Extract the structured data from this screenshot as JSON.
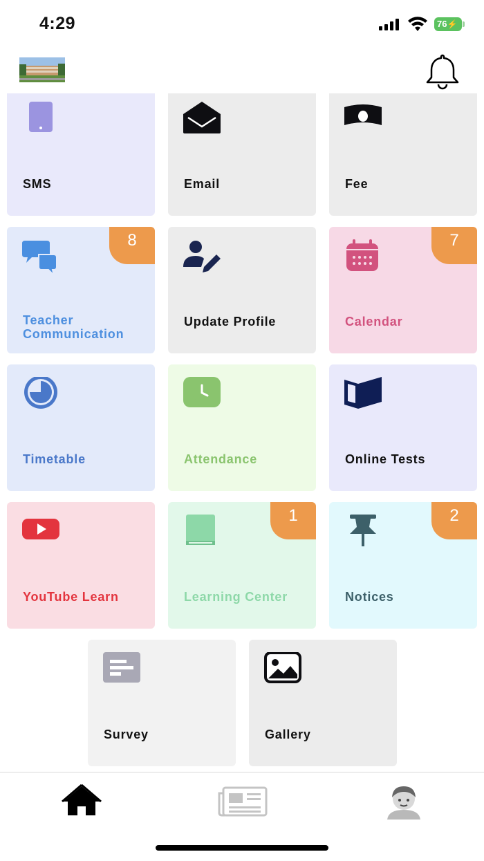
{
  "status": {
    "time": "4:29",
    "battery": "76"
  },
  "tiles": [
    {
      "id": "sms",
      "label": "SMS",
      "icon": "phone-icon",
      "bg": "#e9e9fb",
      "color": "#111111"
    },
    {
      "id": "email",
      "label": "Email",
      "icon": "envelope-open-icon",
      "bg": "#ececec",
      "color": "#111111"
    },
    {
      "id": "fee",
      "label": "Fee",
      "icon": "money-bill-icon",
      "bg": "#ececec",
      "color": "#111111"
    },
    {
      "id": "teacher-communication",
      "label1": "Teacher",
      "label2": "Communication",
      "icon": "chat-bubbles-icon",
      "bg": "#e3eafa",
      "color": "#4d8fdf",
      "badge": "8"
    },
    {
      "id": "update-profile",
      "label": "Update Profile",
      "icon": "user-edit-icon",
      "bg": "#ececec",
      "color": "#111111"
    },
    {
      "id": "calendar",
      "label": "Calendar",
      "icon": "calendar-icon",
      "bg": "#f7d9e6",
      "color": "#d2527e",
      "badge": "7"
    },
    {
      "id": "timetable",
      "label": "Timetable",
      "icon": "clock-pie-icon",
      "bg": "#e3eafa",
      "color": "#4a78c9"
    },
    {
      "id": "attendance",
      "label": "Attendance",
      "icon": "clock-square-icon",
      "bg": "#eefbe6",
      "color": "#8ac46e"
    },
    {
      "id": "online-tests",
      "label": "Online Tests",
      "icon": "book-open-icon",
      "bg": "#e9e9fb",
      "color": "#111111"
    },
    {
      "id": "youtube-learn",
      "label": "YouTube Learn",
      "icon": "youtube-icon",
      "bg": "#fadde3",
      "color": "#e3343e"
    },
    {
      "id": "learning-center",
      "label": "Learning Center",
      "icon": "book-icon",
      "bg": "#e2f8ea",
      "color": "#8dd8a8",
      "badge": "1"
    },
    {
      "id": "notices",
      "label": "Notices",
      "icon": "pin-icon",
      "bg": "#e2f9fd",
      "color": "#3d6069",
      "badge": "2"
    },
    {
      "id": "survey",
      "label": "Survey",
      "icon": "survey-icon",
      "bg": "#f2f2f2",
      "color": "#111111"
    },
    {
      "id": "gallery",
      "label": "Gallery",
      "icon": "image-icon",
      "bg": "#ececec",
      "color": "#111111"
    }
  ],
  "tabbar": [
    {
      "name": "home",
      "icon": "home-icon",
      "active": true
    },
    {
      "name": "news",
      "icon": "newspaper-icon",
      "active": false
    },
    {
      "name": "profile",
      "icon": "avatar-icon",
      "active": false
    }
  ]
}
